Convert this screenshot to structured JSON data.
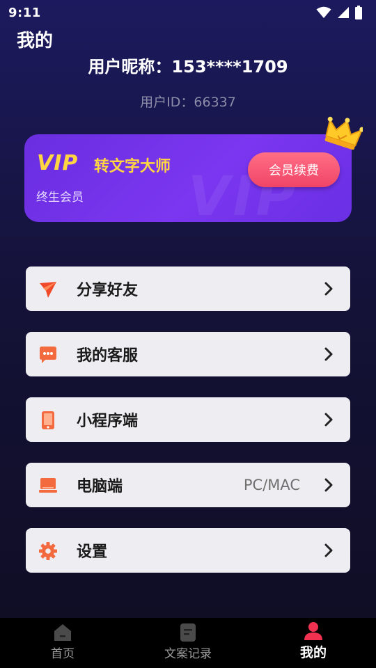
{
  "status_bar": {
    "time": "9:11"
  },
  "page": {
    "title": "我的"
  },
  "user": {
    "nickname": "用户昵称：153****1709",
    "user_id": "用户ID：66337"
  },
  "vip_card": {
    "logo": "VIP",
    "watermark": "VIP",
    "app_name": "转文字大师",
    "member_type": "终生会员",
    "renew_label": "会员续费",
    "accent_color": "#ffd541",
    "card_color": "#7b36f0",
    "button_color": "#f04466"
  },
  "menu": {
    "items": [
      {
        "label": "分享好友",
        "icon": "share-icon",
        "value": ""
      },
      {
        "label": "我的客服",
        "icon": "chat-icon",
        "value": ""
      },
      {
        "label": "小程序端",
        "icon": "phone-icon",
        "value": ""
      },
      {
        "label": "电脑端",
        "icon": "laptop-icon",
        "value": "PC/MAC"
      },
      {
        "label": "设置",
        "icon": "gear-icon",
        "value": ""
      }
    ],
    "icon_color": "#f26a3d"
  },
  "bottom_nav": {
    "items": [
      {
        "label": "首页",
        "icon": "home-icon",
        "active": false
      },
      {
        "label": "文案记录",
        "icon": "document-icon",
        "active": false
      },
      {
        "label": "我的",
        "icon": "user-icon",
        "active": true
      }
    ],
    "active_color": "#f0314f"
  }
}
